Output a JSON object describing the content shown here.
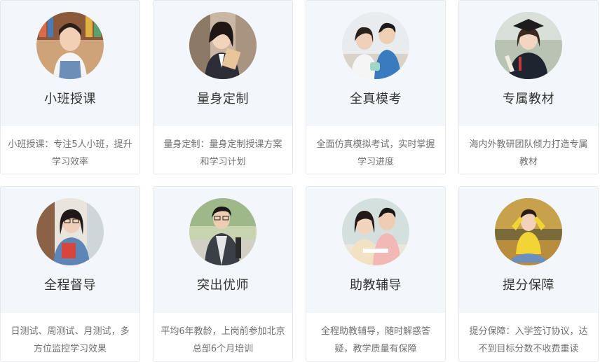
{
  "cards": [
    {
      "title": "小班授课",
      "desc": "小班授课：专注5人小班，提升学习效率"
    },
    {
      "title": "量身定制",
      "desc": "量身定制：量身定制授课方案和学习计划"
    },
    {
      "title": "全真模考",
      "desc": "全面仿真模拟考试，实时掌握学习进度"
    },
    {
      "title": "专属教材",
      "desc": "海内外教研团队倾力打造专属教材"
    },
    {
      "title": "全程督导",
      "desc": "日测试、周测试、月测试，多方位监控学习效果"
    },
    {
      "title": "突出优师",
      "desc": "平均6年教龄，上岗前参加北京总部6个月培训"
    },
    {
      "title": "助教辅导",
      "desc": "全程助教辅导，随时解惑答疑，教学质量有保障"
    },
    {
      "title": "提分保障",
      "desc": "提分保障：入学签订协议，达不到目标分数不收费重读"
    }
  ],
  "colors": {
    "panel": "#f3f6fa",
    "border": "#e6e8ec",
    "title": "#333333",
    "desc": "#707070"
  }
}
